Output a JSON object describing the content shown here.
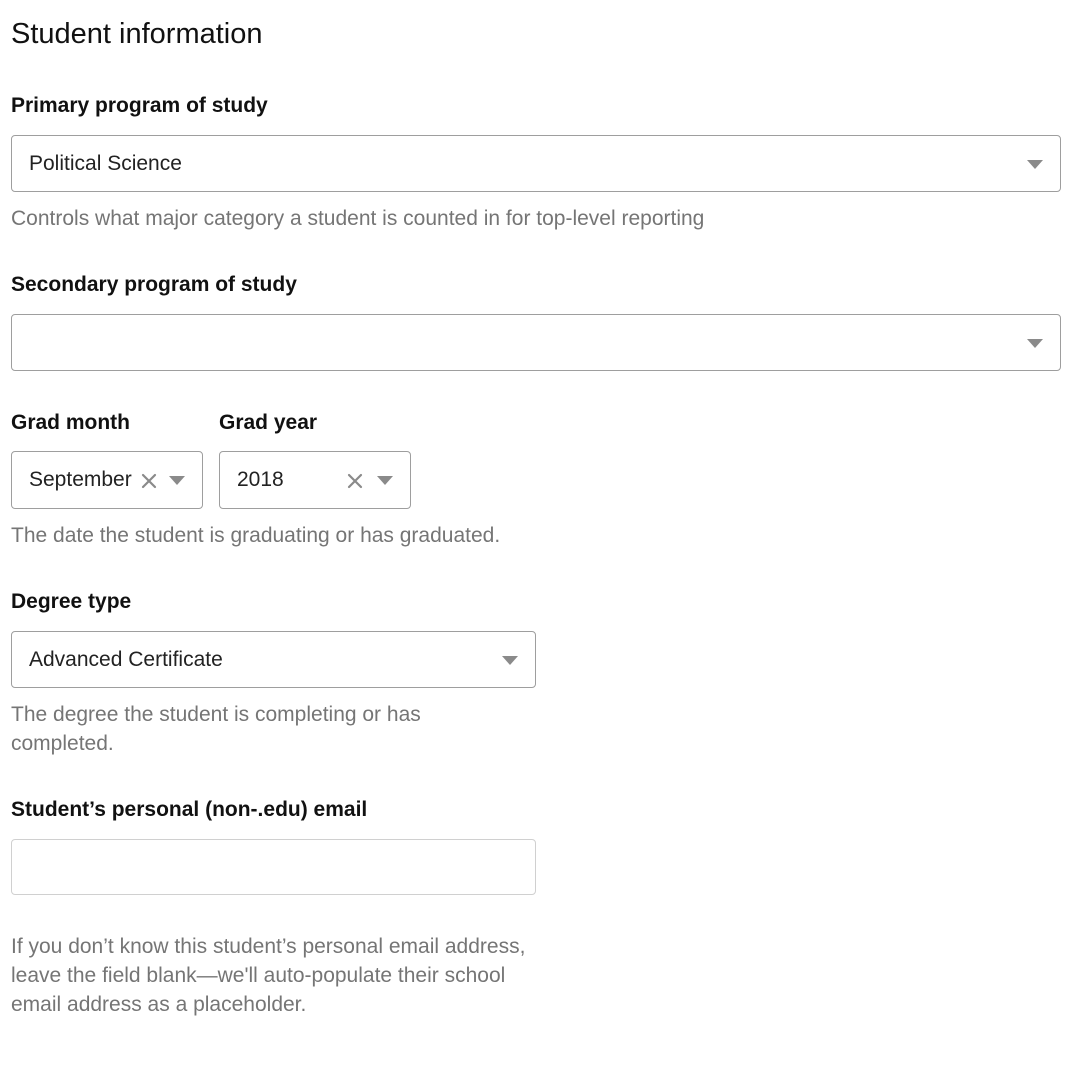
{
  "page": {
    "title": "Student information"
  },
  "primary_program": {
    "label": "Primary program of study",
    "value": "Political Science",
    "help": "Controls what major category a student is counted in for top-level reporting"
  },
  "secondary_program": {
    "label": "Secondary program of study",
    "value": ""
  },
  "grad_month": {
    "label": "Grad month",
    "value": "September"
  },
  "grad_year": {
    "label": "Grad year",
    "value": "2018"
  },
  "grad_help": "The date the student is graduating or has graduated.",
  "degree_type": {
    "label": "Degree type",
    "value": "Advanced Certificate",
    "help": "The degree the student is completing or has completed."
  },
  "personal_email": {
    "label": "Student’s personal (non-.edu) email",
    "value": "",
    "help": "If you don’t know this student’s personal email address, leave the field blank—we'll auto-populate their school email address as a placeholder."
  },
  "icons": {
    "dropdown": "chevron-down-icon",
    "clear": "close-icon"
  },
  "colors": {
    "label": "#111111",
    "help_text": "#757575",
    "border": "#9e9e9e",
    "icon": "#8a8a8a"
  }
}
